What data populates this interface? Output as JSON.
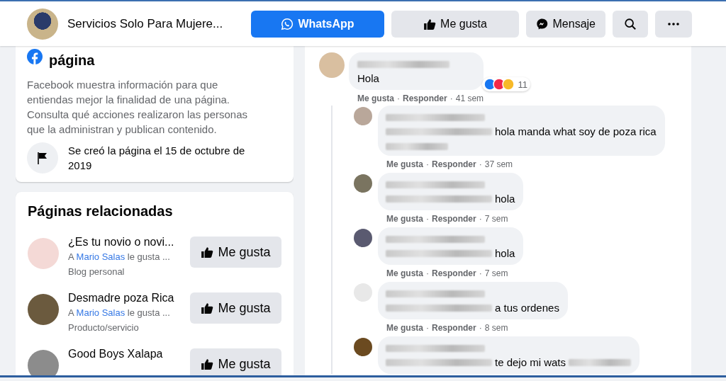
{
  "header": {
    "page_name": "Servicios Solo Para Mujere...",
    "buttons": [
      {
        "kind": "whatsapp",
        "label": "WhatsApp"
      },
      {
        "kind": "like",
        "label": "Me gusta"
      },
      {
        "kind": "message",
        "label": "Mensaje"
      },
      {
        "kind": "search"
      },
      {
        "kind": "more"
      }
    ]
  },
  "transparency": {
    "title": "página",
    "description": "Facebook muestra información para que entiendas mejor la finalidad de una página. Consulta qué acciones realizaron las personas que la administran y publican contenido.",
    "created": "Se creó la página el 15 de octubre de 2019"
  },
  "related_pages": {
    "title": "Páginas relacionadas",
    "items": [
      {
        "name": "¿Es tu novio o novi...",
        "liked_by": {
          "prefix": "A",
          "link": "Mario Salas",
          "suffix": "le gusta ..."
        },
        "category": "Blog personal",
        "button": "Me gusta"
      },
      {
        "name": "Desmadre poza Rica",
        "liked_by": {
          "prefix": "A",
          "link": "Mario Salas",
          "suffix": "le gusta ..."
        },
        "category": "Producto/servicio",
        "button": "Me gusta"
      },
      {
        "name": "Good Boys Xalapa",
        "button": "Me gusta"
      }
    ]
  },
  "comments": {
    "separator": "·",
    "items": [
      {
        "text": "Hola",
        "reactions_count": "11",
        "like": "Me gusta",
        "reply": "Responder",
        "time": "41 sem",
        "replies": [
          {
            "text": "hola manda what soy de poza rica",
            "extra_line": true,
            "blur_after": false,
            "like": "Me gusta",
            "reply": "Responder",
            "time": "37 sem"
          },
          {
            "text": "hola",
            "extra_line": false,
            "blur_after": false,
            "like": "Me gusta",
            "reply": "Responder",
            "time": "7 sem"
          },
          {
            "text": "hola",
            "extra_line": false,
            "blur_after": false,
            "like": "Me gusta",
            "reply": "Responder",
            "time": "7 sem"
          },
          {
            "text": "a tus ordenes",
            "extra_line": false,
            "blur_after": false,
            "like": "Me gusta",
            "reply": "Responder",
            "time": "8 sem"
          },
          {
            "text": "te dejo mi wats",
            "extra_line": false,
            "blur_after": true
          }
        ]
      }
    ]
  }
}
